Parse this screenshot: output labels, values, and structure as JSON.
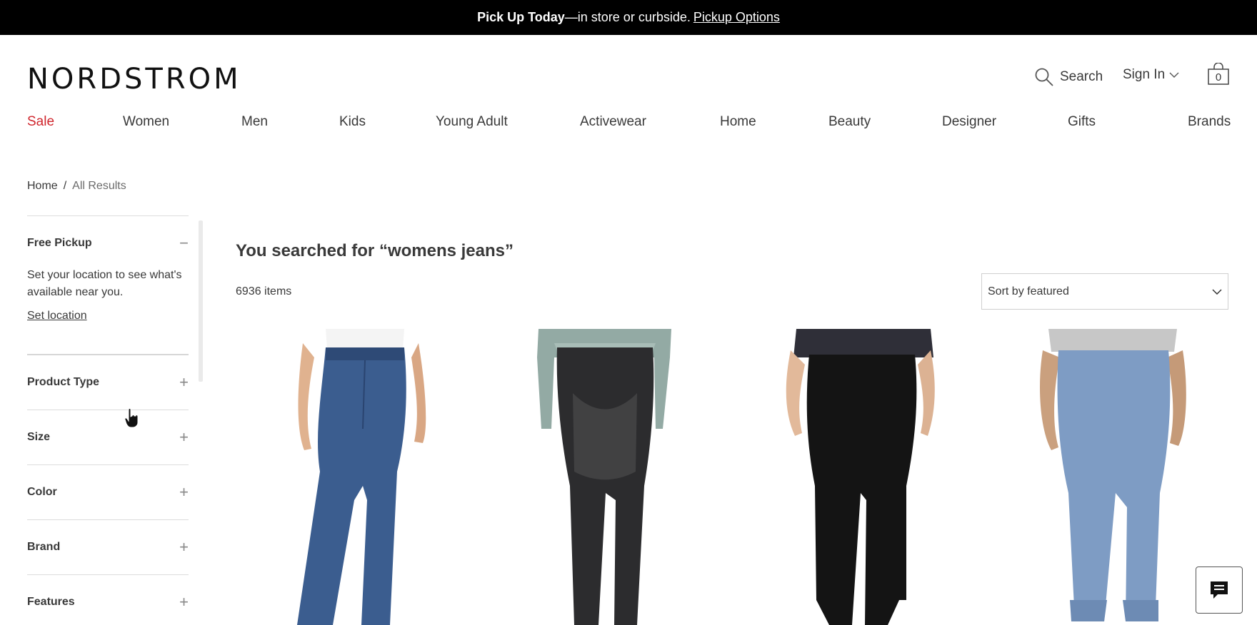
{
  "promo": {
    "bold": "Pick Up Today",
    "text": "—in store or curbside.",
    "link": "Pickup Options"
  },
  "logo": "NORDSTROM",
  "header": {
    "search_label": "Search",
    "signin_label": "Sign In",
    "bag_count": "0"
  },
  "nav": [
    "Sale",
    "Women",
    "Men",
    "Kids",
    "Young Adult",
    "Activewear",
    "Home",
    "Beauty",
    "Designer",
    "Gifts",
    "Brands"
  ],
  "breadcrumb": {
    "home": "Home",
    "sep": "/",
    "current": "All Results"
  },
  "filters": {
    "pickup": {
      "title": "Free Pickup",
      "text": "Set your location to see what's available near you.",
      "link": "Set location"
    },
    "facets": [
      "Product Type",
      "Size",
      "Color",
      "Brand",
      "Features"
    ]
  },
  "results": {
    "heading": "You searched for “womens jeans”",
    "count": "6936 items",
    "sort": "Sort by featured"
  },
  "colors": {
    "sale": "#d0262d",
    "promo_bg": "#000000"
  }
}
